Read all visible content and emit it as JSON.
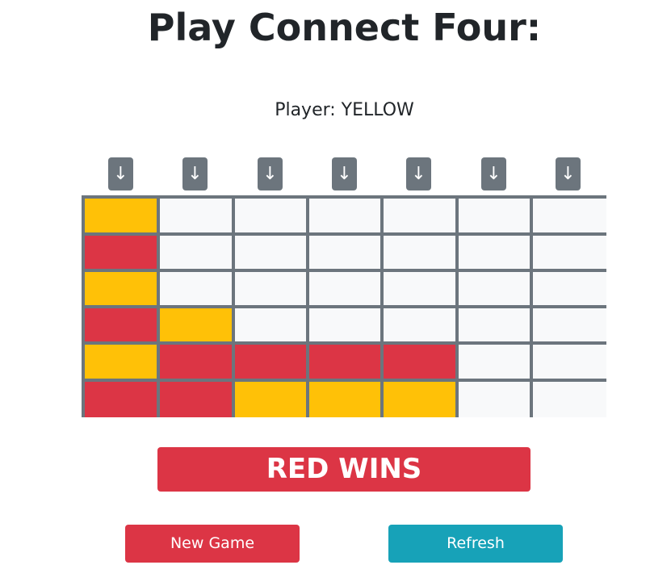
{
  "page": {
    "title": "Play Connect Four:",
    "player_label": "Player: YELLOW"
  },
  "drop_buttons": [
    "↓",
    "↓",
    "↓",
    "↓",
    "↓",
    "↓",
    "↓"
  ],
  "board": {
    "rows": 6,
    "cols": 7,
    "cells": [
      [
        "yellow",
        "empty",
        "empty",
        "empty",
        "empty",
        "empty",
        "empty"
      ],
      [
        "red",
        "empty",
        "empty",
        "empty",
        "empty",
        "empty",
        "empty"
      ],
      [
        "yellow",
        "empty",
        "empty",
        "empty",
        "empty",
        "empty",
        "empty"
      ],
      [
        "red",
        "yellow",
        "empty",
        "empty",
        "empty",
        "empty",
        "empty"
      ],
      [
        "yellow",
        "red",
        "red",
        "red",
        "red",
        "empty",
        "empty"
      ],
      [
        "red",
        "red",
        "yellow",
        "yellow",
        "yellow",
        "empty",
        "empty"
      ]
    ]
  },
  "result": {
    "banner_text": "RED WINS"
  },
  "actions": {
    "new_game_label": "New Game",
    "refresh_label": "Refresh"
  },
  "colors": {
    "red": "#dc3545",
    "yellow": "#ffc107",
    "empty": "#f8f9fa",
    "grid": "#6c757d",
    "refresh": "#17a2b8"
  }
}
